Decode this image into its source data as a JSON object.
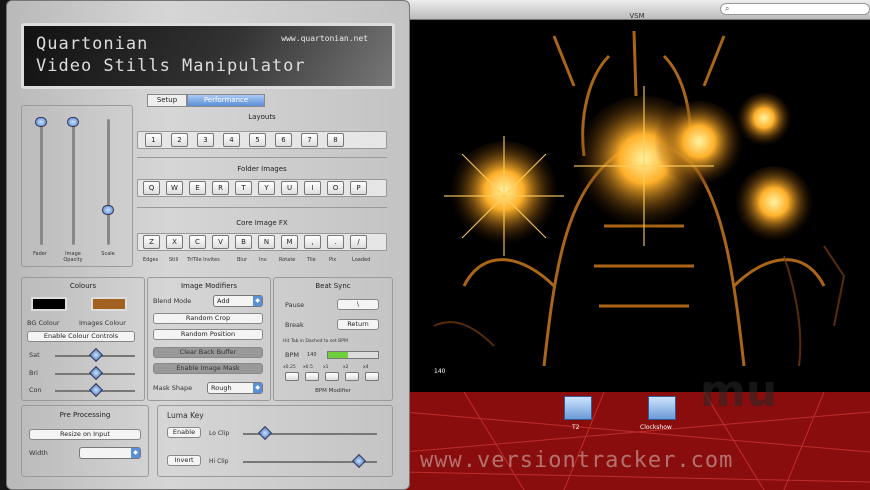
{
  "vj_window": {
    "title": "VSM"
  },
  "bpm_label": "140",
  "desktop": {
    "icons": [
      {
        "label": "T2"
      },
      {
        "label": "Clockshow"
      }
    ],
    "watermark": "www.versiontracker.com",
    "logo": "mu"
  },
  "banner": {
    "line1": "Quartonian",
    "line2": "Video Stills Manipulator",
    "url": "www.quartonian.net"
  },
  "tabs": [
    "Setup",
    "Performance"
  ],
  "sliders": {
    "fader_label": "Fader",
    "opacity_label": "Image\nOpacity",
    "scale_label": "Scale"
  },
  "layouts": {
    "title": "Layouts",
    "keys": [
      "1",
      "2",
      "3",
      "4",
      "5",
      "6",
      "7",
      "8"
    ]
  },
  "folder_images": {
    "title": "Folder Images",
    "keys": [
      "Q",
      "W",
      "E",
      "R",
      "T",
      "Y",
      "U",
      "I",
      "O",
      "P"
    ]
  },
  "core_fx": {
    "title": "Core Image FX",
    "keys": [
      "Z",
      "X",
      "C",
      "V",
      "B",
      "N",
      "M",
      ",",
      ".",
      "/"
    ],
    "labels": [
      "Edges",
      "Still",
      "TriTile Invites",
      "Blur",
      "Inv.",
      "Rotate",
      "Tile",
      "Pix",
      "Loaded"
    ]
  },
  "colours": {
    "title": "Colours",
    "bg_label": "BG Colour",
    "images_label": "Images Colour",
    "enable_label": "Enable Colour Controls",
    "sat_label": "Sat",
    "bri_label": "Bri",
    "con_label": "Con",
    "bg_color": "#000000",
    "images_color": "#a0621e"
  },
  "image_modifiers": {
    "title": "Image Modifiers",
    "blend_label": "Blend Mode",
    "blend_value": "Add",
    "random_crop": "Random Crop",
    "random_position": "Random Position",
    "clear_back_buffer": "Clear Back Buffer",
    "enable_image_mask": "Enable Image Mask",
    "mask_shape_label": "Mask Shape",
    "mask_shape_value": "Rough"
  },
  "beat_sync": {
    "title": "Beat Sync",
    "pause_label": "Pause",
    "pause_key": "\\",
    "break_label": "Break",
    "break_key": "Return",
    "hint": "Hit Tab in Dashed to set BPM",
    "bpm_label": "BPM",
    "bpm_value": "140",
    "multipliers": [
      "x0.25",
      "x0.5",
      "x1",
      "x2",
      "x4"
    ],
    "mod_label": "BPM Modifier"
  },
  "pre_processing": {
    "title": "Pre Processing",
    "resize_label": "Resize on Input",
    "width_label": "Width"
  },
  "luma_key": {
    "title": "Luma Key",
    "enable_label": "Enable",
    "lo_clip": "Lo Clip",
    "invert_label": "Invert",
    "hi_clip": "Hi Clip"
  }
}
